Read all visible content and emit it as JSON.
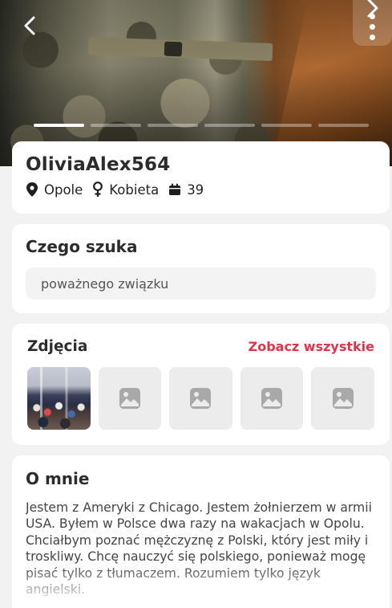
{
  "hero": {
    "photo_count": 6,
    "active_photo_index": 0,
    "back_icon": "chevron-left-icon",
    "next_icon": "chevron-right-icon",
    "more_icon": "more-vertical-icon"
  },
  "profile": {
    "username": "OliviaAlex564",
    "location": "Opole",
    "gender": "Kobieta",
    "age": "39",
    "location_icon": "map-pin-icon",
    "gender_icon": "female-icon",
    "age_icon": "calendar-icon"
  },
  "seeking": {
    "title": "Czego szuka",
    "value": "poważnego związku"
  },
  "photos": {
    "title": "Zdjęcia",
    "see_all": "Zobacz wszystkie",
    "thumbs": [
      "photo",
      "placeholder",
      "placeholder",
      "placeholder",
      "placeholder"
    ],
    "placeholder_icon": "image-icon"
  },
  "about": {
    "title": "O mnie",
    "text": "Jestem z Ameryki z Chicago. Jestem żołnierzem w armii USA. Byłem w Polsce dwa razy na wakacjach w Opolu. Chciałbym poznać mężczyznę z Polski, który jest miły i troskliwy. Chcę nauczyć się polskiego, ponieważ mogę pisać tylko z tłumaczem. Rozumiem tylko język angielski."
  },
  "colors": {
    "accent": "#e0334a",
    "background": "#f2f2f2",
    "card": "#ffffff"
  }
}
